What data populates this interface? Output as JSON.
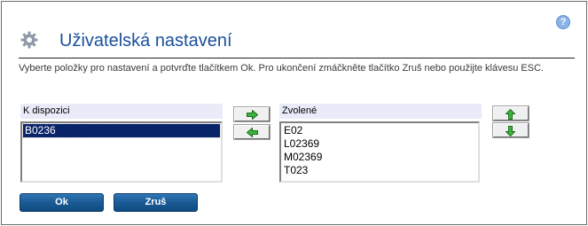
{
  "header": {
    "title": "Uživatelská nastavení",
    "help_label": "?",
    "instructions": "Vyberte položky pro nastavení a potvrďte tlačítkem Ok. Pro ukončení zmáčkněte tlačítko Zruš nebo použijte klávesu ESC."
  },
  "available": {
    "label": "K dispozici",
    "items": [
      "B0236"
    ],
    "selected_index": 0
  },
  "chosen": {
    "label": "Zvolené",
    "items": [
      "E02",
      "L02369",
      "M02369",
      "T023"
    ]
  },
  "icons": {
    "settings": "gear-icon",
    "help": "help-icon",
    "move_right": "arrow-right-icon",
    "move_left": "arrow-left-icon",
    "move_up": "arrow-up-icon",
    "move_down": "arrow-down-icon"
  },
  "colors": {
    "title": "#1a4f9a",
    "arrow_green": "#2e9a2e",
    "selection": "#0a246a",
    "button": "#1a5a94"
  },
  "buttons": {
    "ok_label": "Ok",
    "cancel_label": "Zruš"
  }
}
